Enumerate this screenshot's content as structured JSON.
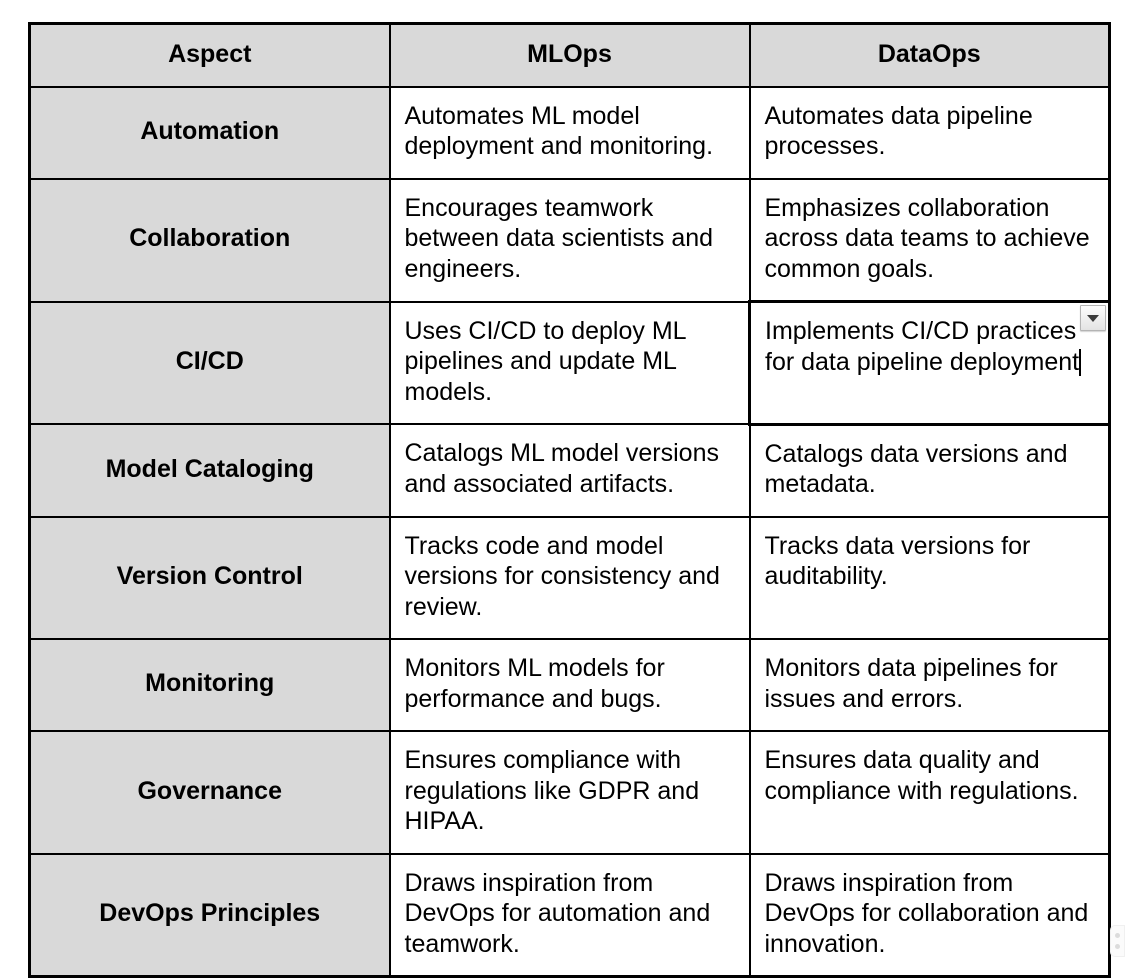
{
  "table": {
    "columns": [
      "Aspect",
      "MLOps",
      "DataOps"
    ],
    "rows": [
      {
        "aspect": "Automation",
        "mlops": "Automates ML model deployment and monitoring.",
        "dataops": "Automates data pipeline processes."
      },
      {
        "aspect": "Collaboration",
        "mlops": "Encourages teamwork between data scientists and engineers.",
        "dataops": "Emphasizes collaboration across data teams to achieve common goals."
      },
      {
        "aspect": "CI/CD",
        "mlops": "Uses CI/CD to deploy ML pipelines and update ML models.",
        "dataops": "Implements CI/CD practices for data pipeline deployment"
      },
      {
        "aspect": "Model Cataloging",
        "mlops": "Catalogs ML model versions and associated artifacts.",
        "dataops": "Catalogs data versions and metadata."
      },
      {
        "aspect": "Version Control",
        "mlops": "Tracks code and model versions for consistency and review.",
        "dataops": "Tracks data versions for auditability."
      },
      {
        "aspect": "Monitoring",
        "mlops": "Monitors ML models for performance and bugs.",
        "dataops": "Monitors data pipelines for issues and errors."
      },
      {
        "aspect": "Governance",
        "mlops": "Ensures compliance with regulations like GDPR and HIPAA.",
        "dataops": "Ensures data quality and compliance with regulations."
      },
      {
        "aspect": "DevOps Principles",
        "mlops": "Draws inspiration from DevOps for automation and teamwork.",
        "dataops": "Draws inspiration from DevOps for collaboration and innovation."
      }
    ]
  },
  "editing_cell": {
    "row_index": 2,
    "column": "dataops",
    "dropdown_icon": "chevron-down-icon",
    "caret_visible": true
  },
  "grip": {
    "icon": "drag-grip-icon",
    "dots": 2
  },
  "colors": {
    "header_background": "#d9d9d9",
    "aspect_background": "#d9d9d9",
    "cell_background": "#ffffff",
    "border": "#000000",
    "text": "#000000"
  }
}
